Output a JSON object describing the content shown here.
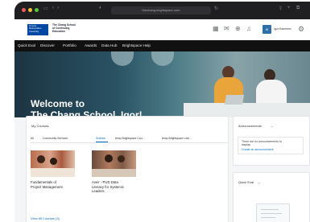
{
  "browser": {
    "url": "thechang.brightspace.com"
  },
  "header": {
    "logo_university": "Toronto Metropolitan University",
    "logo_school_line1": "The Chang School",
    "logo_school_line2": "of Continuing",
    "logo_school_line3": "Education",
    "avatar_initials": "IK",
    "user_name": "Igor Kamenev"
  },
  "nav": {
    "items": [
      "Quick Eval",
      "Discover",
      "Portfolio",
      "Awards",
      "Data Hub",
      "Brightspace Help"
    ]
  },
  "hero": {
    "welcome_line1": "Welcome to",
    "welcome_line2": "The Chang School, Igor!"
  },
  "my_courses": {
    "title": "My Courses",
    "tabs": [
      "All",
      "Community Services",
      "Science",
      "temp Brightspace Cou...",
      "temp Brightspace Lear..."
    ],
    "active_tab": "Science",
    "courses": [
      {
        "name_line1": "Fundamentals of",
        "name_line2": "Project Management",
        "name_line3": ""
      },
      {
        "name_line1": "Aveir - PUD Data",
        "name_line2": "Literacy for Systemic",
        "name_line3": "Leaders"
      }
    ],
    "view_all": "View All Courses (3)"
  },
  "announcements": {
    "title": "Announcements",
    "empty_text_line1": "There are no announcements to",
    "empty_text_line2": "display.",
    "create_link": "Create an announcement"
  },
  "quick_eval": {
    "title": "Quick Eval"
  },
  "colors": {
    "brand_blue": "#0046a3",
    "link_blue": "#006fbf",
    "nav_bg": "#111111"
  }
}
